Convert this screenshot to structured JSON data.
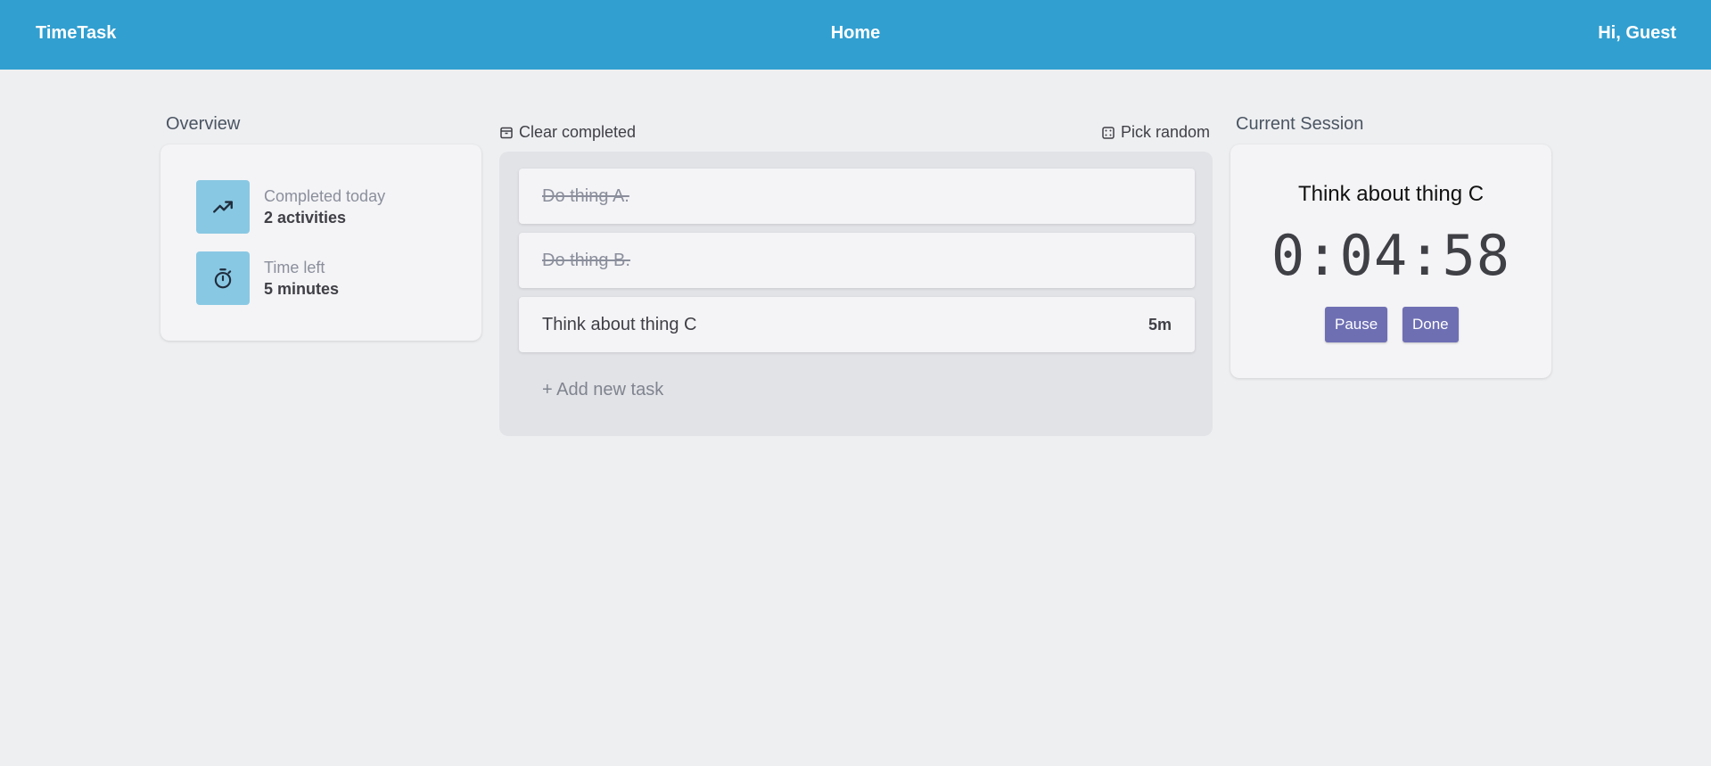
{
  "header": {
    "brand": "TimeTask",
    "nav_home": "Home",
    "greeting": "Hi, Guest",
    "bg_color": "#319fd0"
  },
  "overview": {
    "title": "Overview",
    "stats": [
      {
        "icon": "trending-up-icon",
        "label": "Completed today",
        "value": "2 activities"
      },
      {
        "icon": "stopwatch-icon",
        "label": "Time left",
        "value": "5 minutes"
      }
    ]
  },
  "toolbar": {
    "clear_completed": "Clear completed",
    "clear_icon": "archive-icon",
    "pick_random": "Pick random",
    "pick_icon": "dice-icon"
  },
  "tasks": [
    {
      "name": "Do thing A.",
      "duration": "",
      "completed": true
    },
    {
      "name": "Do thing B.",
      "duration": "",
      "completed": true
    },
    {
      "name": "Think about thing C",
      "duration": "5m",
      "completed": false
    }
  ],
  "add_task_label": "+ Add new task",
  "session": {
    "title": "Current Session",
    "task_name": "Think about thing C",
    "timer": "0:04:58",
    "pause_label": "Pause",
    "done_label": "Done",
    "button_color": "#6e6fb3"
  }
}
